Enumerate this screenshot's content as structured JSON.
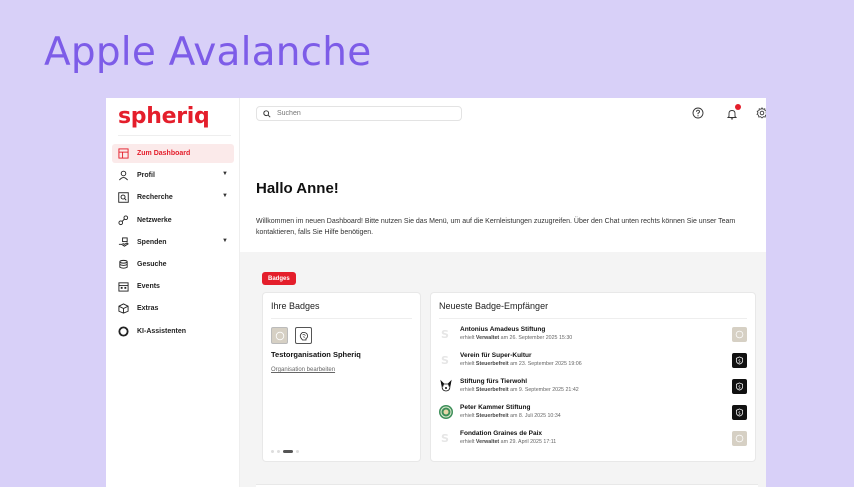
{
  "headline": "Apple Avalanche",
  "brand": {
    "logo_text": "spheriq",
    "accent": "#e41e2b"
  },
  "sidebar": {
    "items": [
      {
        "label": "Zum Dashboard",
        "icon": "dashboard-icon",
        "active": true,
        "expandable": false
      },
      {
        "label": "Profil",
        "icon": "user-icon",
        "active": false,
        "expandable": true
      },
      {
        "label": "Recherche",
        "icon": "search-box-icon",
        "active": false,
        "expandable": true
      },
      {
        "label": "Netzwerke",
        "icon": "network-icon",
        "active": false,
        "expandable": false
      },
      {
        "label": "Spenden",
        "icon": "donation-icon",
        "active": false,
        "expandable": true
      },
      {
        "label": "Gesuche",
        "icon": "coins-icon",
        "active": false,
        "expandable": false
      },
      {
        "label": "Events",
        "icon": "calendar-icon",
        "active": false,
        "expandable": false
      },
      {
        "label": "Extras",
        "icon": "box-icon",
        "active": false,
        "expandable": false
      },
      {
        "label": "KI-Assistenten",
        "icon": "ai-ring-icon",
        "active": false,
        "expandable": false
      }
    ]
  },
  "topbar": {
    "search_placeholder": "Suchen",
    "icons": [
      "help-icon",
      "bell-icon",
      "settings-icon"
    ]
  },
  "main": {
    "greeting": "Hallo Anne!",
    "welcome_text": "Willkommen im neuen Dashboard! Bitte nutzen Sie das Menü, um auf die Kernleistungen zuzugreifen. Über den Chat unten rechts können Sie unser Team kontaktieren, falls Sie Hilfe benötigen.",
    "section_pill": "Badges",
    "my_badges": {
      "title": "Ihre Badges",
      "org_name": "Testorganisation Spheriq",
      "edit_link": "Organisation bearbeiten"
    },
    "recipients": {
      "title": "Neueste Badge-Empfänger",
      "items": [
        {
          "name": "Antonius Amadeus Stiftung",
          "prefix": "erhielt",
          "badge": "Verwaltet",
          "date": "am 26. September 2025 15:30",
          "badge_style": "gray",
          "avatar": "placeholder"
        },
        {
          "name": "Verein für Super-Kultur",
          "prefix": "erhielt",
          "badge": "Steuerbefreit",
          "date": "am 23. September 2025 19:06",
          "badge_style": "black",
          "avatar": "placeholder"
        },
        {
          "name": "Stiftung fürs Tierwohl",
          "prefix": "erhielt",
          "badge": "Steuerbefreit",
          "date": "am 9. September 2025 21:42",
          "badge_style": "black",
          "avatar": "dog"
        },
        {
          "name": "Peter Kammer Stiftung",
          "prefix": "erhielt",
          "badge": "Steuerbefreit",
          "date": "am 8. Juli 2025 10:34",
          "badge_style": "black",
          "avatar": "green-seal"
        },
        {
          "name": "Fondation Graines de Paix",
          "prefix": "erhielt",
          "badge": "Verwaltet",
          "date": "am 29. April 2025 17:11",
          "badge_style": "gray",
          "avatar": "placeholder"
        }
      ]
    }
  }
}
